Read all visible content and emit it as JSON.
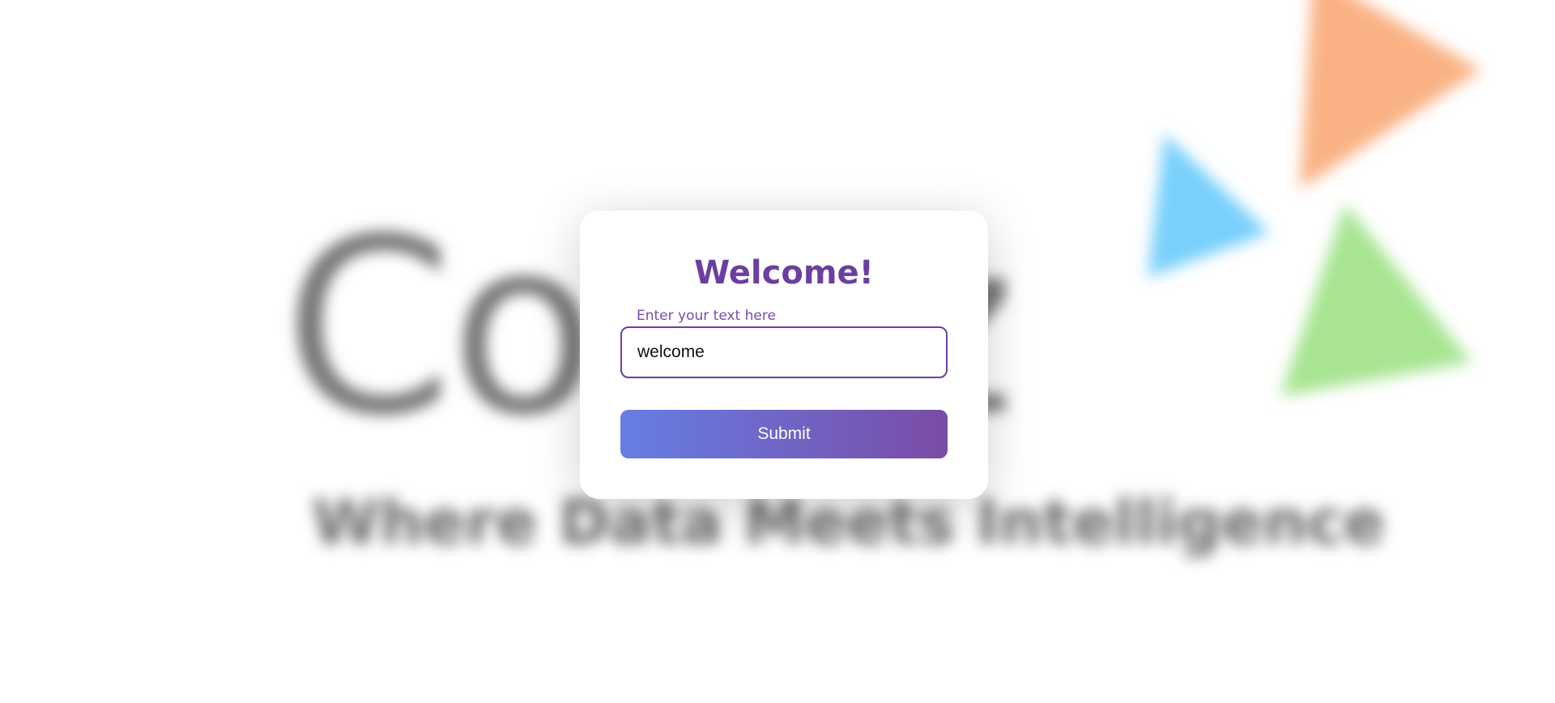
{
  "background": {
    "logo_word": "Co  fyz",
    "tagline": "Where Data Meets Intelligence",
    "shape_colors": {
      "orange": "#f9a26a",
      "blue": "#5cc6fb",
      "green": "#94e07a"
    }
  },
  "card": {
    "title": "Welcome!",
    "input": {
      "label": "Enter your text here",
      "value": "welcome"
    },
    "submit_label": "Submit"
  },
  "colors": {
    "accent": "#6b3fa0",
    "button_gradient_start": "#667ee4",
    "button_gradient_end": "#7a4ca6"
  }
}
